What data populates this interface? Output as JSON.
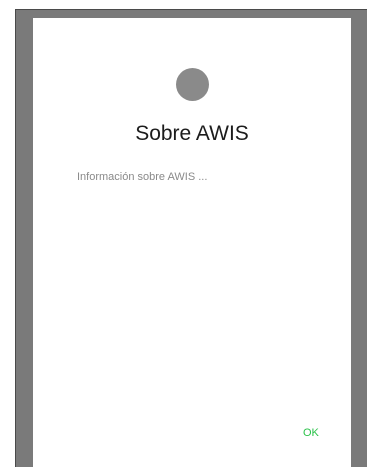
{
  "dialog": {
    "icon": "app-logo-icon",
    "title": "Sobre AWIS",
    "message": "Información sobre AWIS ...",
    "ok_label": "OK"
  },
  "colors": {
    "scrim": "#7a7a7a",
    "icon": "#8a8a8a",
    "accent": "#2bc24a"
  }
}
